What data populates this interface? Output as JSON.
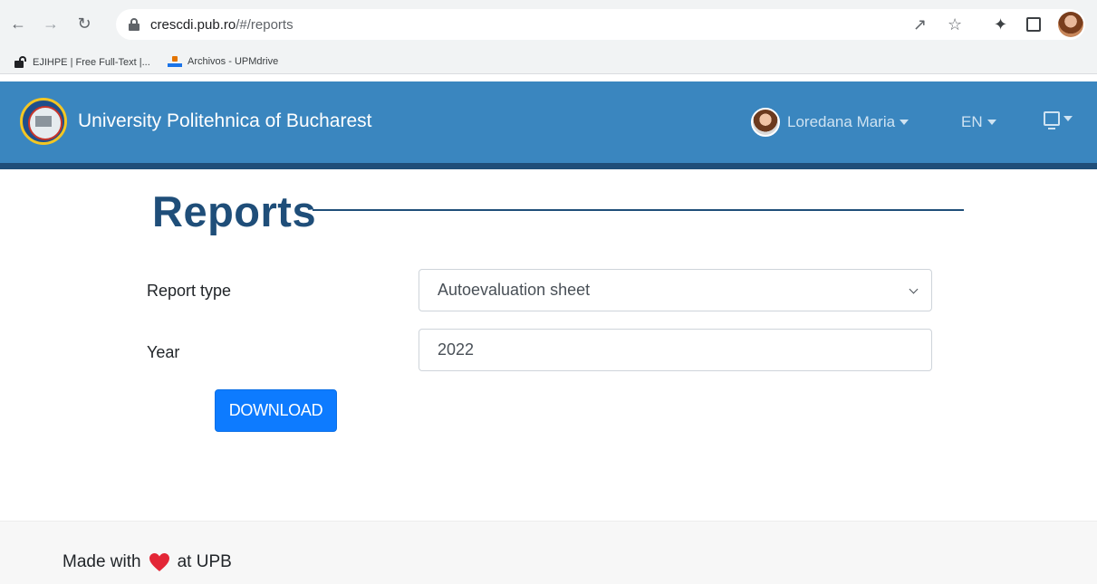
{
  "browser": {
    "url_host": "crescdi.pub.ro",
    "url_path": "/#/reports",
    "bookmarks": [
      {
        "label": "EJIHPE | Free Full-Text |..."
      },
      {
        "label": "Archivos - UPMdrive"
      }
    ],
    "icons": [
      "back-arrow-icon",
      "forward-arrow-icon",
      "reload-icon",
      "lock-icon",
      "share-icon",
      "star-icon",
      "extensions-icon",
      "side-panel-icon",
      "profile-avatar"
    ]
  },
  "navbar": {
    "brand": "University Politehnica of Bucharest",
    "user": "Loredana Maria",
    "language": "EN",
    "colors": {
      "background": "#3a86bf",
      "border": "#1f4e79"
    }
  },
  "page": {
    "title": "Reports",
    "form": {
      "report_type_label": "Report type",
      "report_type_value": "Autoevaluation sheet",
      "year_label": "Year",
      "year_value": "2022",
      "download_label": "DOWNLOAD"
    },
    "colors": {
      "title": "#1f4e79",
      "button": "#0d7bff"
    }
  },
  "footer": {
    "made_with": "Made with",
    "at": "at UPB",
    "heart_color": "#e32636"
  }
}
